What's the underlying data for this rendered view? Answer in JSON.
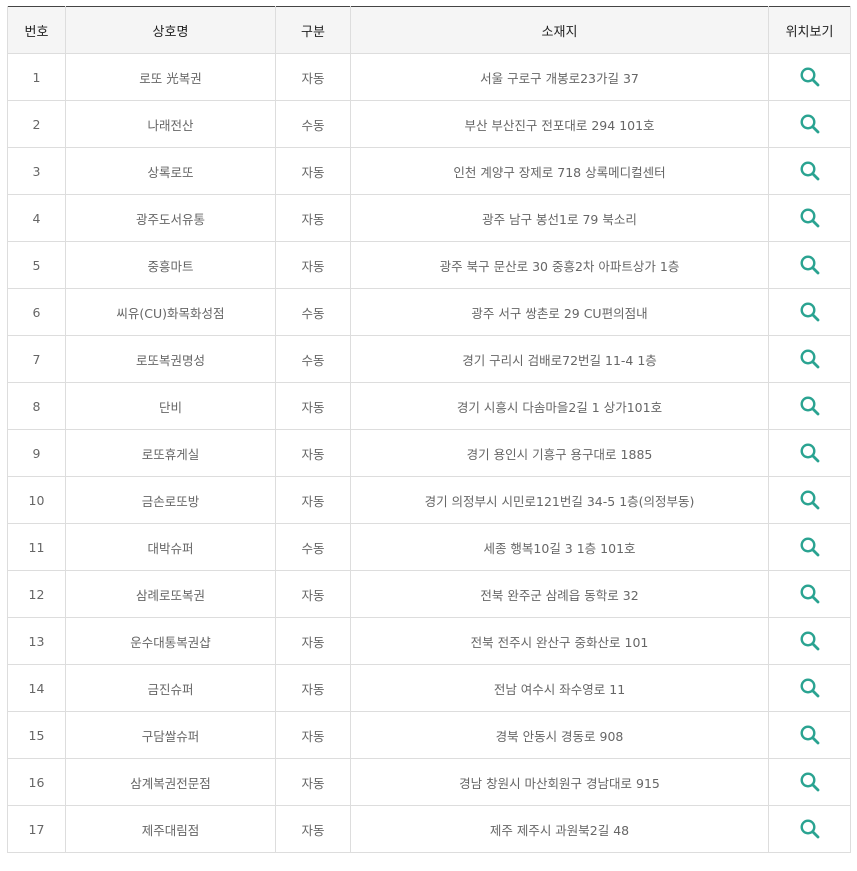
{
  "table": {
    "headers": {
      "no": "번호",
      "name": "상호명",
      "type": "구분",
      "address": "소재지",
      "location": "위치보기"
    },
    "icon": "search-icon",
    "icon_color": "#2aa391",
    "rows": [
      {
        "no": "1",
        "name": "로또 光복권",
        "type": "자동",
        "address": "서울 구로구 개봉로23가길 37"
      },
      {
        "no": "2",
        "name": "나래전산",
        "type": "수동",
        "address": "부산 부산진구 전포대로 294 101호"
      },
      {
        "no": "3",
        "name": "상록로또",
        "type": "자동",
        "address": "인천 계양구 장제로 718 상록메디컬센터"
      },
      {
        "no": "4",
        "name": "광주도서유통",
        "type": "자동",
        "address": "광주 남구 봉선1로 79 북소리"
      },
      {
        "no": "5",
        "name": "중흥마트",
        "type": "자동",
        "address": "광주 북구 문산로 30 중흥2차 아파트상가 1층"
      },
      {
        "no": "6",
        "name": "씨유(CU)화목화성점",
        "type": "수동",
        "address": "광주 서구 쌍촌로 29 CU편의점내"
      },
      {
        "no": "7",
        "name": "로또복권명성",
        "type": "수동",
        "address": "경기 구리시 검배로72번길 11-4 1층"
      },
      {
        "no": "8",
        "name": "단비",
        "type": "자동",
        "address": "경기 시흥시 다솜마을2길 1 상가101호"
      },
      {
        "no": "9",
        "name": "로또휴게실",
        "type": "자동",
        "address": "경기 용인시 기흥구 용구대로 1885"
      },
      {
        "no": "10",
        "name": "금손로또방",
        "type": "자동",
        "address": "경기 의정부시 시민로121번길 34-5 1층(의정부동)"
      },
      {
        "no": "11",
        "name": "대박슈퍼",
        "type": "수동",
        "address": "세종 행복10길 3 1층 101호"
      },
      {
        "no": "12",
        "name": "삼례로또복권",
        "type": "자동",
        "address": "전북 완주군 삼례읍 동학로 32"
      },
      {
        "no": "13",
        "name": "운수대통복권샵",
        "type": "자동",
        "address": "전북 전주시 완산구 중화산로 101"
      },
      {
        "no": "14",
        "name": "금진슈퍼",
        "type": "자동",
        "address": "전남 여수시 좌수영로 11"
      },
      {
        "no": "15",
        "name": "구담쌀슈퍼",
        "type": "자동",
        "address": "경북 안동시 경동로 908"
      },
      {
        "no": "16",
        "name": "삼계복권전문점",
        "type": "자동",
        "address": "경남 창원시 마산회원구 경남대로 915"
      },
      {
        "no": "17",
        "name": "제주대림점",
        "type": "자동",
        "address": "제주 제주시 과원북2길 48"
      }
    ]
  }
}
